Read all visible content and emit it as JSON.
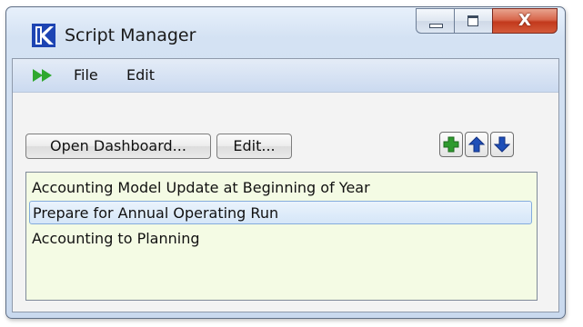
{
  "window": {
    "title": "Script Manager",
    "close_glyph": "X"
  },
  "menu": {
    "run_icon": "run-arrows-icon",
    "items": [
      "File",
      "Edit"
    ]
  },
  "toolbar": {
    "open_dashboard_label": "Open Dashboard...",
    "edit_label": "Edit...",
    "add_icon": "plus-icon",
    "up_icon": "arrow-up-icon",
    "down_icon": "arrow-down-icon"
  },
  "scripts": {
    "items": [
      "Accounting Model Update at Beginning of Year",
      "Prepare for Annual Operating Run",
      "Accounting to Planning"
    ],
    "selected_index": 1
  },
  "colors": {
    "list_background": "#f4fbe4",
    "selection": "#d5e6f8",
    "close_button": "#c2391c",
    "run_icon": "#2fa82f",
    "add_icon": "#2e9a2e",
    "arrow_icon": "#1f4fb8"
  }
}
